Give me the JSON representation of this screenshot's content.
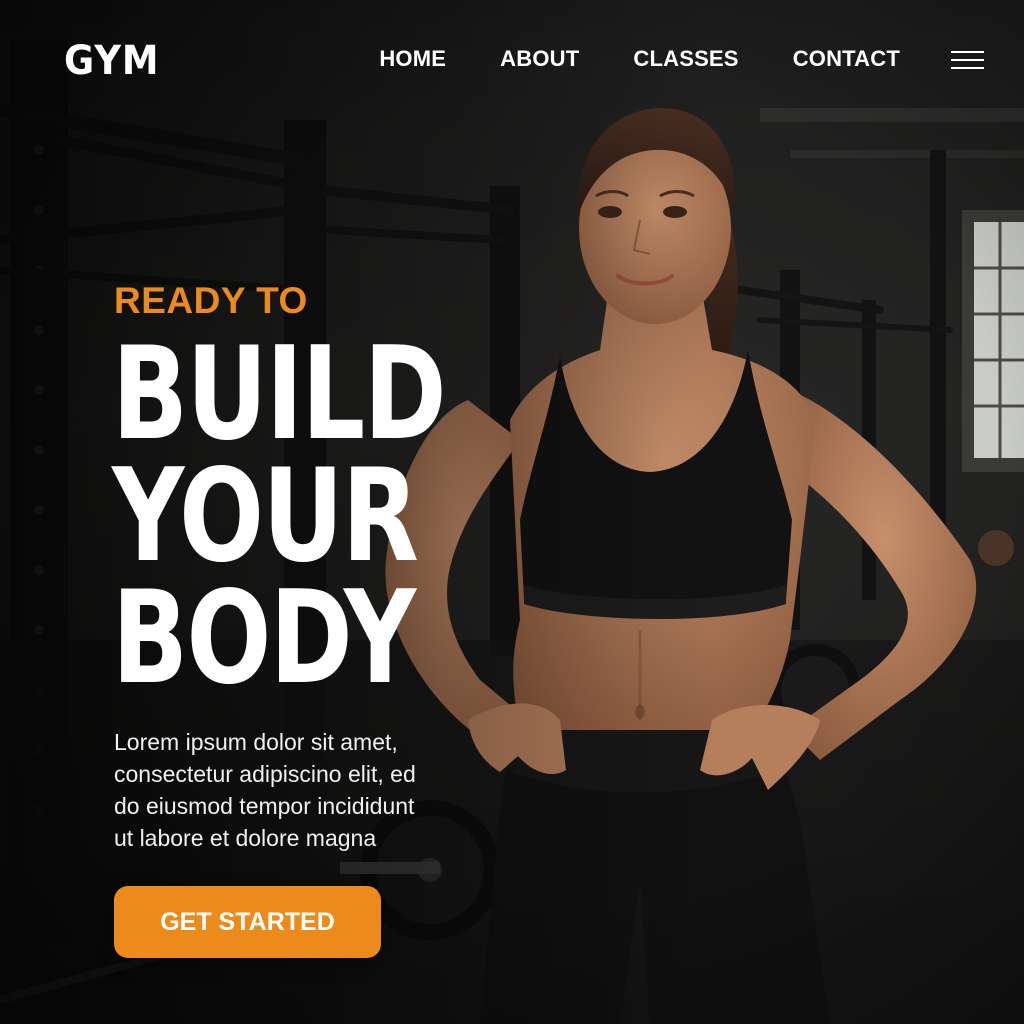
{
  "brand": {
    "name": "GYM"
  },
  "nav": {
    "items": [
      {
        "label": "HOME"
      },
      {
        "label": "ABOUT"
      },
      {
        "label": "CLASSES"
      },
      {
        "label": "CONTACT"
      }
    ],
    "menu_icon": "hamburger-icon"
  },
  "hero": {
    "kicker": "READY TO",
    "headline_lines": [
      "BUILD",
      "YOUR",
      "BODY"
    ],
    "description": "Lorem ipsum dolor sit amet, consectetur adipiscino elit, ed do eiusmod tempor incididunt ut labore et dolore magna",
    "cta_label": "GET STARTED"
  },
  "colors": {
    "accent": "#ED8A1C",
    "text": "#FFFFFF",
    "background": "#1C1C1B"
  }
}
